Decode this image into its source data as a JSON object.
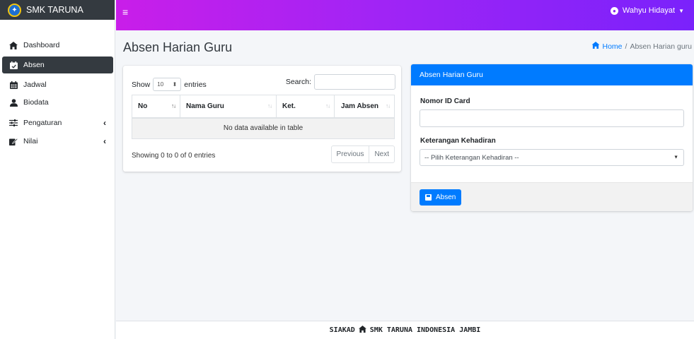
{
  "brand": {
    "name": "SMK TARUNA",
    "logo_icon": "school-logo-icon"
  },
  "sidebar": {
    "items": [
      {
        "label": "Dashboard",
        "icon": "home-icon"
      },
      {
        "label": "Absen",
        "icon": "calendar-check-icon"
      },
      {
        "label": "Jadwal",
        "icon": "calendar-icon"
      },
      {
        "label": "Biodata",
        "icon": "user-icon"
      },
      {
        "label": "Pengaturan",
        "icon": "sliders-icon"
      },
      {
        "label": "Nilai",
        "icon": "edit-icon"
      }
    ]
  },
  "navbar": {
    "menu_icon": "hamburger-icon",
    "user_name": "Wahyu Hidayat",
    "colors": [
      "#c91ee9",
      "#7a22fb"
    ]
  },
  "page": {
    "title": "Absen Harian Guru"
  },
  "breadcrumb": {
    "home": "Home",
    "separator": "/",
    "current": "Absen Harian guru"
  },
  "table_card": {
    "show_label": "Show",
    "length_value": "10",
    "entries_label": "entries",
    "search_label": "Search:",
    "columns": [
      "No",
      "Nama Guru",
      "Ket.",
      "Jam Absen"
    ],
    "empty_text": "No data available in table",
    "info": "Showing 0 to 0 of 0 entries",
    "prev": "Previous",
    "next": "Next"
  },
  "form_card": {
    "header": "Absen Harian Guru",
    "id_label": "Nomor ID Card",
    "id_value": "",
    "ket_label": "Keterangan Kehadiran",
    "ket_selected": "-- Pilih Keterangan Kehadiran --",
    "submit": "Absen",
    "accent": "#007bff"
  },
  "footer": {
    "left": "SIAKAD",
    "right": "SMK TARUNA INDONESIA JAMBI"
  }
}
